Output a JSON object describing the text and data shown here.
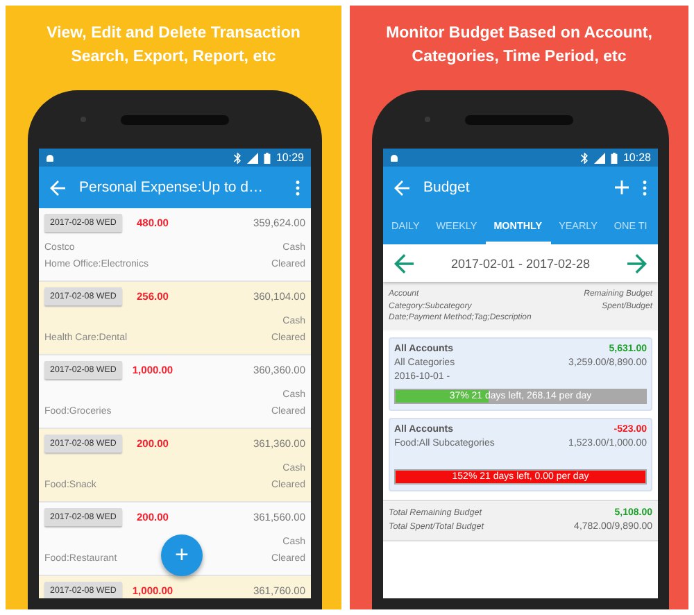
{
  "panels": [
    {
      "kind": "transactions",
      "headline": "View, Edit and Delete Transaction\nSearch, Export, Report, etc",
      "screen": {
        "status_time": "10:29",
        "title": "Personal Expense:Up to d…",
        "transactions": [
          {
            "date": "2017-02-08 WED",
            "amount": "480.00",
            "balance": "359,624.00",
            "payee": "Costco",
            "account": "Cash",
            "category": "Home Office:Electronics",
            "status": "Cleared"
          },
          {
            "date": "2017-02-08 WED",
            "amount": "256.00",
            "balance": "360,104.00",
            "account": "Cash",
            "category": "Health Care:Dental",
            "status": "Cleared"
          },
          {
            "date": "2017-02-08 WED",
            "amount": "1,000.00",
            "balance": "360,360.00",
            "account": "Cash",
            "category": "Food:Groceries",
            "status": "Cleared"
          },
          {
            "date": "2017-02-08 WED",
            "amount": "200.00",
            "balance": "361,360.00",
            "account": "Cash",
            "category": "Food:Snack",
            "status": "Cleared"
          },
          {
            "date": "2017-02-08 WED",
            "amount": "200.00",
            "balance": "361,560.00",
            "account": "Cash",
            "category": "Food:Restaurant",
            "status": "Cleared"
          },
          {
            "date": "2017-02-08 WED",
            "amount": "1,000.00",
            "balance": "361,760.00"
          }
        ],
        "fab_label": "+"
      }
    },
    {
      "kind": "budget",
      "headline": "Monitor Budget Based on Account,\nCategories, Time Period, etc",
      "screen": {
        "status_time": "10:28",
        "title": "Budget",
        "tabs": [
          {
            "label": "DAILY",
            "selected": false
          },
          {
            "label": "WEEKLY",
            "selected": false
          },
          {
            "label": "MONTHLY",
            "selected": true
          },
          {
            "label": "YEARLY",
            "selected": false
          },
          {
            "label": "ONE TI",
            "selected": false
          }
        ],
        "period": "2017-02-01 - 2017-02-28",
        "header": {
          "left": [
            "Account",
            "Category:Subcategory",
            "Date;Payment Method;Tag;Description"
          ],
          "right": [
            "Remaining Budget",
            "Spent/Budget"
          ]
        },
        "budgets": [
          {
            "account": "All Accounts",
            "remaining": "5,631.00",
            "category": "All Categories",
            "spent": "3,259.00/8,890.00",
            "date": "2016-10-01 -",
            "over_budget": false,
            "level": 0.37,
            "bar_label": "37%  21 days left, 268.14 per day"
          },
          {
            "account": "All Accounts",
            "remaining": "-523.00",
            "category": "Food:All Subcategories",
            "spent": "1,523.00/1,000.00",
            "over_budget": true,
            "level": 1,
            "bar_label": "152%  21 days left, 0.00 per day"
          }
        ],
        "totals": {
          "remaining_label": "Total Remaining Budget",
          "remaining": "5,108.00",
          "spent_label": "Total Spent/Total Budget",
          "spent": "4,782.00/9,890.00"
        }
      }
    }
  ]
}
